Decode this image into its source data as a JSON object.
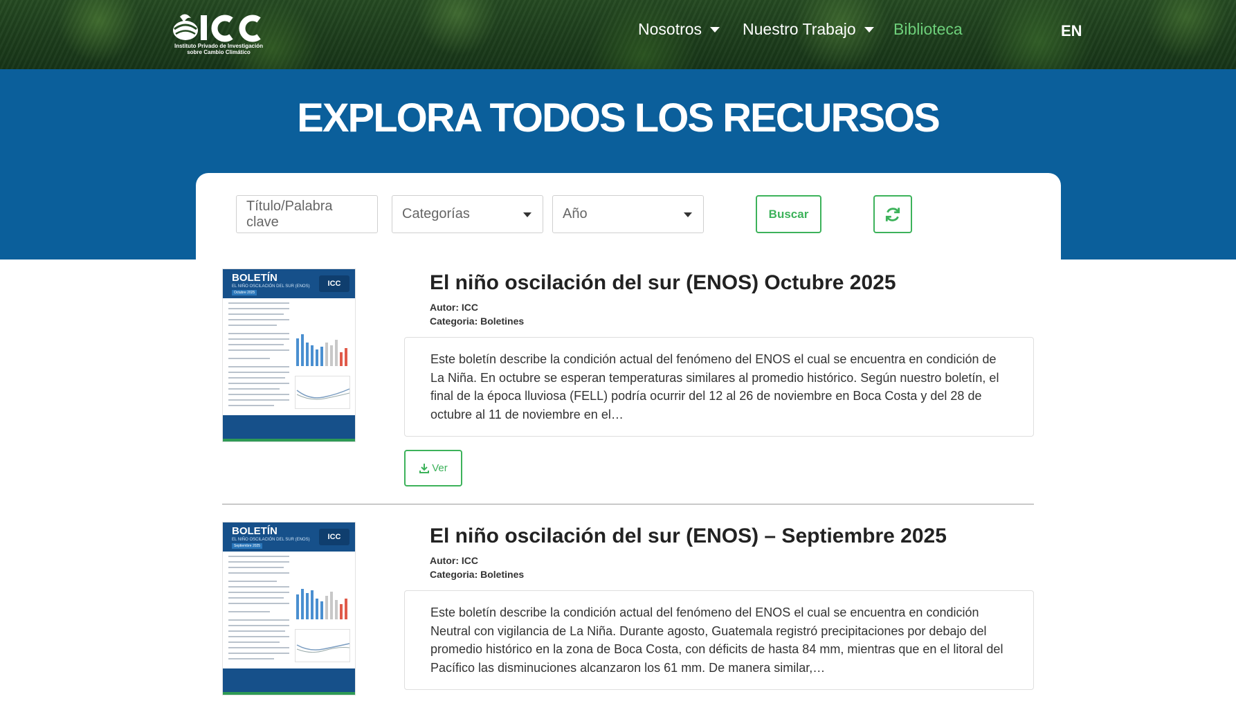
{
  "header": {
    "logo_text": "Instituto Privado de Investigación sobre Cambio Climático",
    "logo_wordmark": "ICC",
    "nav": [
      {
        "label": "Nosotros",
        "dropdown": true
      },
      {
        "label": "Nuestro Trabajo",
        "dropdown": true
      },
      {
        "label": "Biblioteca",
        "dropdown": false,
        "active": true
      }
    ],
    "lang_switch": "EN"
  },
  "banner": {
    "title": "EXPLORA TODOS LOS RECURSOS"
  },
  "filters": {
    "keyword_placeholder": "Título/Palabra clave",
    "category_placeholder": "Categorías",
    "year_placeholder": "Año",
    "search_label": "Buscar",
    "refresh_icon": "refresh-icon"
  },
  "results": [
    {
      "title": "El niño oscilación del sur (ENOS) Octubre 2025",
      "author": "Autor: ICC",
      "category": "Categoria: Boletines",
      "description": "Este boletín describe la condición actual del fenómeno del ENOS el cual se encuentra en condición de La Niña. En octubre se esperan temperaturas similares al promedio histórico. Según nuestro boletín, el final de la época lluviosa (FELL) podría ocurrir del 12 al 26 de noviembre en Boca Costa y del 28 de octubre al 11 de noviembre en el…",
      "view_label": "Ver",
      "thumb": {
        "heading": "BOLETÍN",
        "subtitle": "EL NIÑO OSCILACIÓN DEL SUR (ENOS)",
        "month": "Octubre 2025",
        "logo": "ICC"
      }
    },
    {
      "title": "El niño oscilación del sur (ENOS) – Septiembre 2025",
      "author": "Autor: ICC",
      "category": "Categoria: Boletines",
      "description": "Este boletín describe la condición actual del fenómeno del ENOS el cual se encuentra en condición Neutral con vigilancia de La Niña. Durante agosto, Guatemala registró precipitaciones por debajo del promedio histórico en la zona de Boca Costa, con déficits de hasta 84 mm, mientras que en el litoral del Pacífico las disminuciones alcanzaron los 61 mm. De manera similar,…",
      "thumb": {
        "heading": "BOLETÍN",
        "subtitle": "EL NIÑO OSCILACIÓN DEL SUR (ENOS)",
        "month": "Septiembre 2025",
        "logo": "ICC"
      }
    }
  ],
  "colors": {
    "banner_blue": "#0b5f9b",
    "accent_green": "#3cb25a",
    "nav_active": "#6dcf7a"
  }
}
